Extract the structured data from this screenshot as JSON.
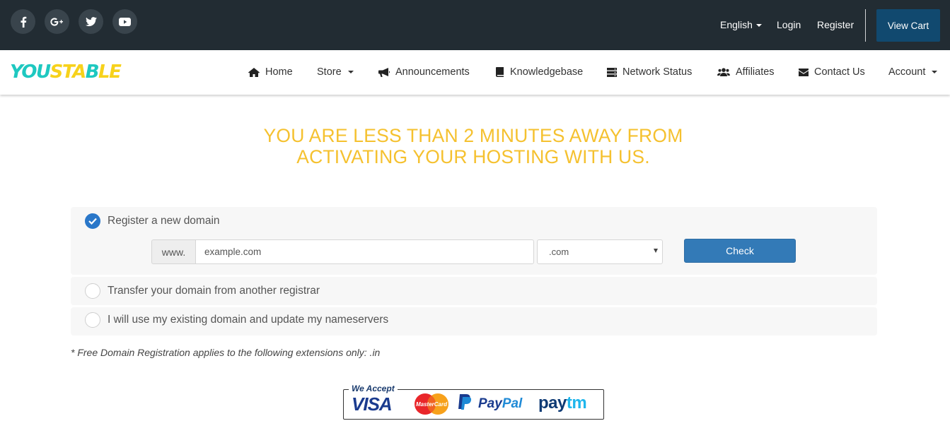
{
  "topbar": {
    "social": [
      {
        "name": "facebook-icon",
        "glyph": "f"
      },
      {
        "name": "google-plus-icon",
        "glyph": "G+"
      },
      {
        "name": "twitter-icon",
        "glyph": "twitter"
      },
      {
        "name": "youtube-icon",
        "glyph": "youtube"
      }
    ],
    "language": "English",
    "login": "Login",
    "register": "Register",
    "view_cart": "View Cart"
  },
  "brand": {
    "part1": "YOU",
    "part2": "STA",
    "part3": "B",
    "part4": "LE"
  },
  "nav": {
    "home": "Home",
    "store": "Store",
    "announcements": "Announcements",
    "knowledgebase": "Knowledgebase",
    "network_status": "Network Status",
    "affiliates": "Affiliates",
    "contact_us": "Contact Us",
    "account": "Account"
  },
  "headline": {
    "line1": "YOU ARE LESS THAN 2 MINUTES AWAY FROM",
    "line2": "ACTIVATING YOUR HOSTING WITH US."
  },
  "domain_options": {
    "register": {
      "label": "Register a new domain",
      "selected": true
    },
    "transfer": {
      "label": "Transfer your domain from another registrar",
      "selected": false
    },
    "existing": {
      "label": "I will use my existing domain and update my nameservers",
      "selected": false
    }
  },
  "domain_form": {
    "prefix": "www.",
    "placeholder": "example.com",
    "tld": ".com",
    "check_label": "Check"
  },
  "footnote": "* Free Domain Registration applies to the following extensions only: .in",
  "payments": {
    "heading": "We Accept",
    "visa": "VISA",
    "mastercard": "MasterCard",
    "paypal_a": "Pay",
    "paypal_b": "Pal",
    "paytm_a": "pay",
    "paytm_b": "tm"
  },
  "colors": {
    "topbar": "#222c33",
    "accent_yellow": "#f5c12f",
    "brand_teal": "#1ec8c0",
    "check_button": "#337ab7",
    "view_cart": "#11496f"
  }
}
